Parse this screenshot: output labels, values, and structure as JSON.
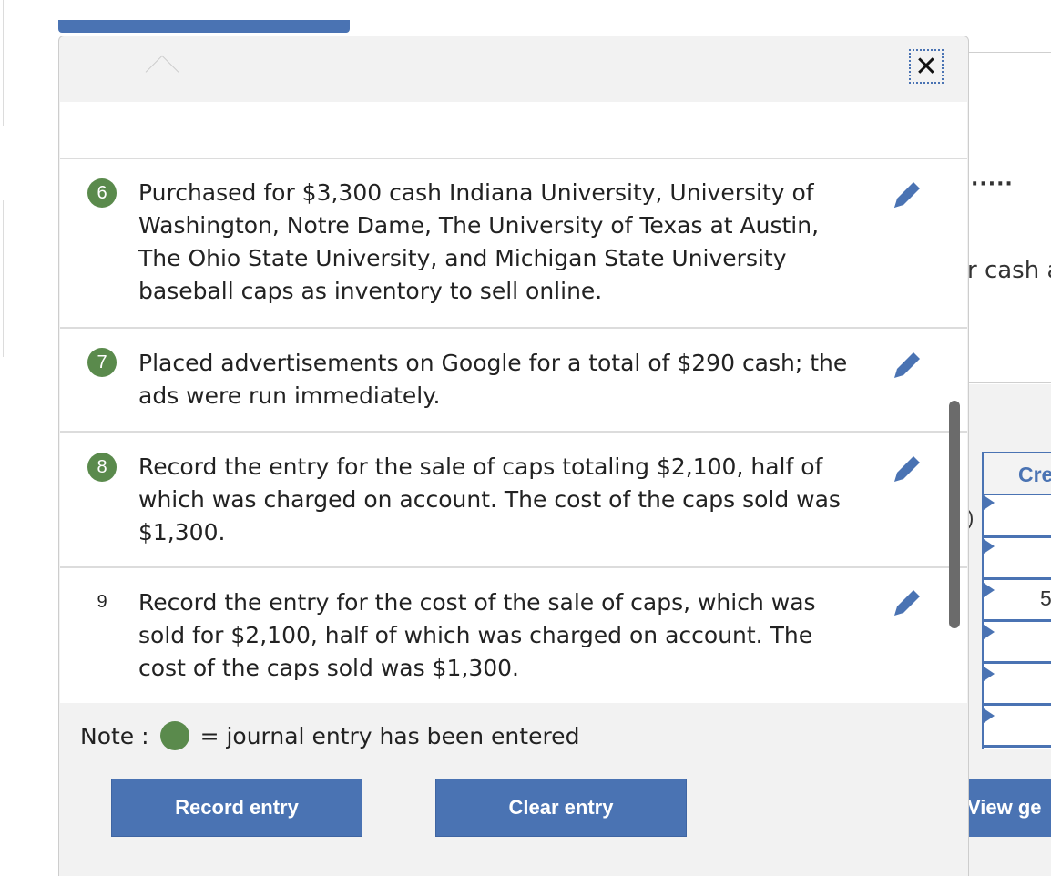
{
  "popover": {
    "close_label": "✕",
    "items": [
      {
        "number": "6",
        "completed": true,
        "text": "Purchased for $3,300 cash Indiana University, University of Washington, Notre Dame, The University of Texas at Austin, The Ohio State University, and Michigan State University baseball caps as inventory to sell online.",
        "edit_icon": "pencil-icon"
      },
      {
        "number": "7",
        "completed": true,
        "text": "Placed advertisements on Google for a total of $290 cash; the ads were run immediately.",
        "edit_icon": "pencil-icon"
      },
      {
        "number": "8",
        "completed": true,
        "text": "Record the entry for the sale of caps totaling $2,100, half of which was charged on account. The cost of the caps sold was $1,300.",
        "edit_icon": "pencil-icon"
      },
      {
        "number": "9",
        "completed": false,
        "text": "Record the entry for the cost of the sale of caps, which was sold for $2,100, half of which was charged on account. The cost of the caps sold was $1,300.",
        "edit_icon": "pencil-icon"
      }
    ],
    "note_label": "Note :",
    "note_text": "= journal entry has been entered"
  },
  "buttons": {
    "record_entry": "Record entry",
    "clear_entry": "Clear entry",
    "view_general": "View ge"
  },
  "background": {
    "dots": "·····",
    "cash_fragment": "r cash a",
    "table_header_fragment": "Cre",
    "cell_fragment": "5",
    "left_mark": ")"
  },
  "colors": {
    "accent_blue": "#4a73b3",
    "completed_green": "#5a8a4c",
    "panel_grey": "#f2f2f2"
  }
}
